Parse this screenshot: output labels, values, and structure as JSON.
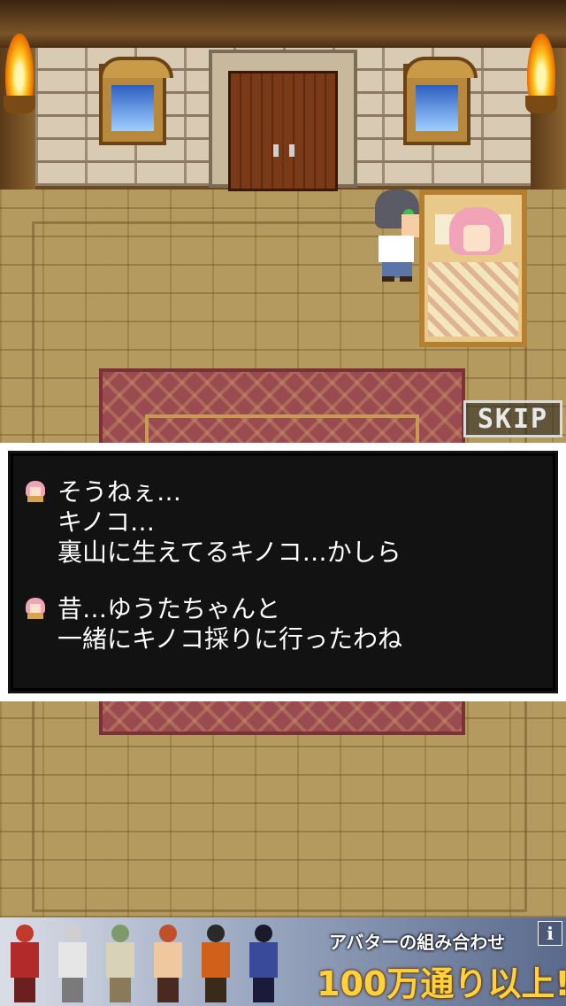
{
  "skip_button": {
    "label": "SKIP"
  },
  "dialog": {
    "blocks": [
      {
        "lines": [
          "そうねぇ…",
          "キノコ…",
          "裏山に生えてるキノコ…かしら"
        ]
      },
      {
        "lines": [
          "昔…ゆうたちゃんと",
          "一緒にキノコ採りに行ったわね"
        ]
      }
    ]
  },
  "ad": {
    "headline": "アバターの組み合わせ",
    "tagline": "100万通り以上!",
    "info_label": "i"
  }
}
